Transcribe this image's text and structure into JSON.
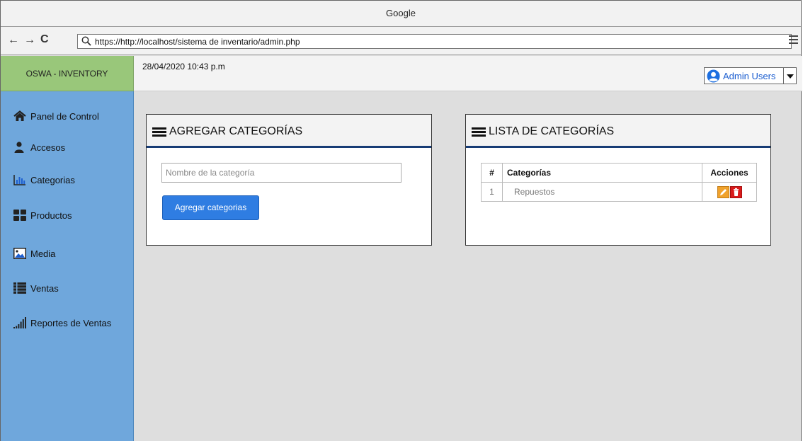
{
  "browser": {
    "title": "Google",
    "url": "https://http://localhost/sistema de inventario/admin.php"
  },
  "brand": {
    "name": "OSWA - INVENTORY",
    "color": "#99c77a"
  },
  "header": {
    "datetime": "28/04/2020 10:43 p.m",
    "user": {
      "label": "Admin Users",
      "icon": "user-circle-icon"
    }
  },
  "sidebar": {
    "color": "#6fa7dc",
    "items": [
      {
        "label": "Panel de Control",
        "icon": "home-icon"
      },
      {
        "label": "Accesos",
        "icon": "user-icon"
      },
      {
        "label": "Categorias",
        "icon": "bar-chart-icon"
      },
      {
        "label": "Productos",
        "icon": "grid-icon"
      },
      {
        "label": "Media",
        "icon": "image-icon"
      },
      {
        "label": "Ventas",
        "icon": "list-icon"
      },
      {
        "label": "Reportes de Ventas",
        "icon": "signal-icon"
      }
    ]
  },
  "add_panel": {
    "title": "AGREGAR CATEGORÍAS",
    "input_placeholder": "Nombre de la categoría",
    "button_label": "Agregar categorias"
  },
  "list_panel": {
    "title": "LISTA DE CATEGORÍAS",
    "columns": [
      "#",
      "Categorías",
      "Acciones"
    ],
    "rows": [
      {
        "num": "1",
        "name": "Repuestos"
      }
    ],
    "actions": {
      "edit_color": "#f0a22c",
      "delete_color": "#d91b1b"
    }
  }
}
